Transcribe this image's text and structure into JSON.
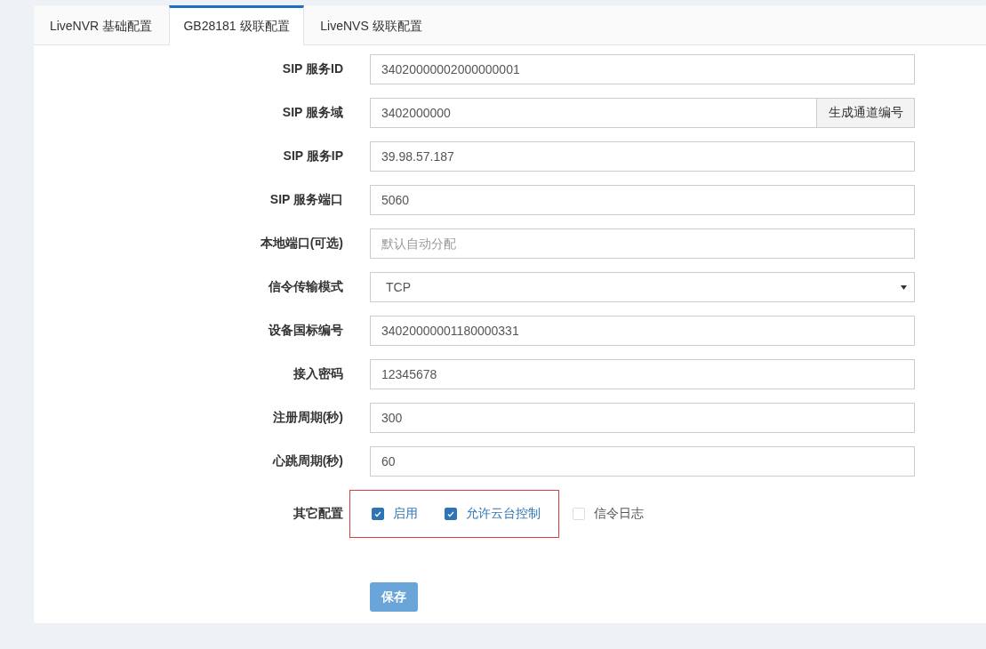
{
  "tabs": [
    {
      "label": "LiveNVR 基础配置",
      "selected": false
    },
    {
      "label": "GB28181 级联配置",
      "selected": true
    },
    {
      "label": "LiveNVS 级联配置",
      "selected": false
    }
  ],
  "form": {
    "fields": [
      {
        "kind": "input",
        "label": "SIP 服务ID",
        "value": "34020000002000000001"
      },
      {
        "kind": "input-button",
        "label": "SIP 服务域",
        "value": "3402000000",
        "button": "生成通道编号"
      },
      {
        "kind": "input",
        "label": "SIP 服务IP",
        "value": "39.98.57.187"
      },
      {
        "kind": "input",
        "label": "SIP 服务端口",
        "value": "5060"
      },
      {
        "kind": "input",
        "label": "本地端口(可选)",
        "placeholder": "默认自动分配"
      },
      {
        "kind": "select",
        "label": "信令传输模式",
        "value": "TCP"
      },
      {
        "kind": "input",
        "label": "设备国标编号",
        "value": "34020000001180000331"
      },
      {
        "kind": "input",
        "label": "接入密码",
        "value": "12345678"
      },
      {
        "kind": "input",
        "label": "注册周期(秒)",
        "value": "300"
      },
      {
        "kind": "input",
        "label": "心跳周期(秒)",
        "value": "60"
      }
    ],
    "options": {
      "label": "其它配置",
      "checkboxes": [
        {
          "label": "启用",
          "checked": true,
          "highlighted": true
        },
        {
          "label": "允许云台控制",
          "checked": true,
          "highlighted": true
        },
        {
          "label": "信令日志",
          "checked": false,
          "highlighted": false
        }
      ]
    },
    "save_button": "保存"
  }
}
